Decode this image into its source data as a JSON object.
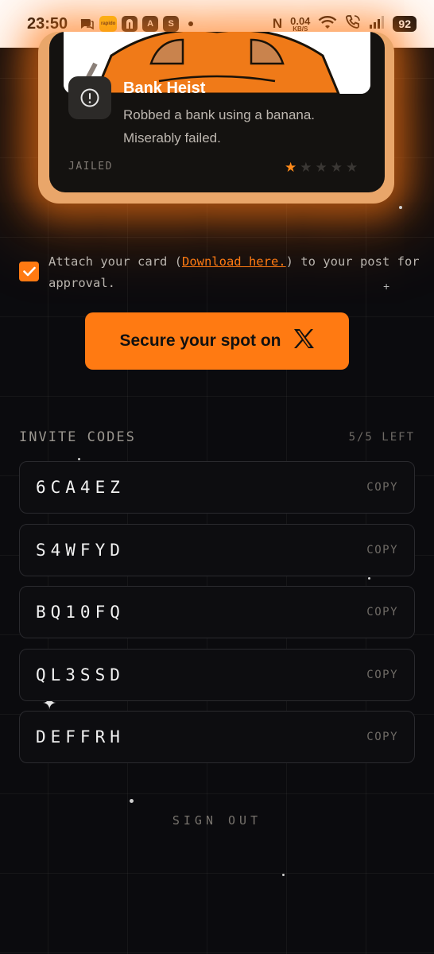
{
  "status_bar": {
    "time": "23:50",
    "app_icons": [
      "chat-icon",
      "rapido-icon",
      "app-icon",
      "app-icon",
      "app-icon"
    ],
    "rapido_label": "rapido",
    "app_a_label": "A",
    "app_s_label": "S",
    "nfc_label": "N",
    "net_speed_value": "0.04",
    "net_speed_unit": "KB/S",
    "battery": "92"
  },
  "card": {
    "title": "Bank Heist",
    "description": "Robbed a bank using a banana. Miserably failed.",
    "status": "JAILED",
    "rating": 1,
    "rating_max": 5
  },
  "attach": {
    "checked": true,
    "text_before": "Attach your card (",
    "link_text": "Download here.",
    "text_after": ") to your post for approval."
  },
  "cta": {
    "label": "Secure your spot on",
    "accent": "#ff7a12"
  },
  "invite_codes": {
    "label": "INVITE CODES",
    "count": "5/5 LEFT",
    "copy_label": "COPY",
    "codes": [
      "6CA4EZ",
      "S4WFYD",
      "BQ10FQ",
      "QL3SSD",
      "DEFFRH"
    ]
  },
  "sign_out": "SIGN OUT"
}
